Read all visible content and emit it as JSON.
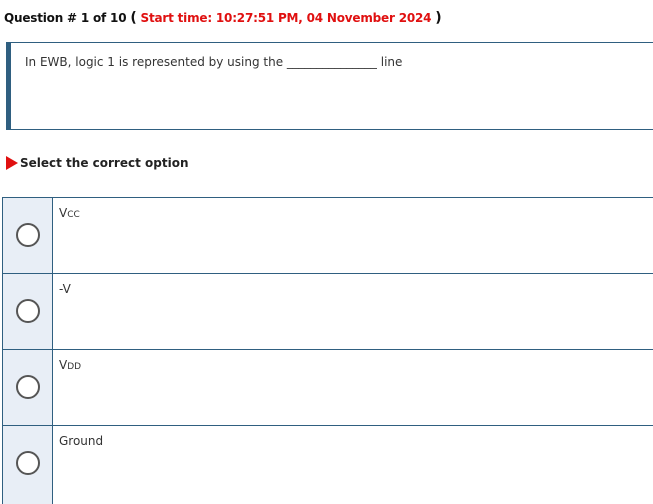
{
  "header": {
    "question_label": "Question # 1 of 10",
    "open_paren": "(",
    "start_time": "Start time: 10:27:51 PM, 04 November 2024",
    "close_paren": ")"
  },
  "question": {
    "text_before": "In EWB, logic 1 is represented by using the",
    "blank": "_______________",
    "text_after": "line"
  },
  "select_prompt": "Select the correct option",
  "options": [
    {
      "main": "V",
      "sub": "CC"
    },
    {
      "main": "-V",
      "sub": ""
    },
    {
      "main": "V",
      "sub": "DD"
    },
    {
      "main": "Ground",
      "sub": ""
    }
  ],
  "colors": {
    "accent": "#2f5f80",
    "start_time": "#e01010",
    "option_bg": "#e8eef6"
  }
}
